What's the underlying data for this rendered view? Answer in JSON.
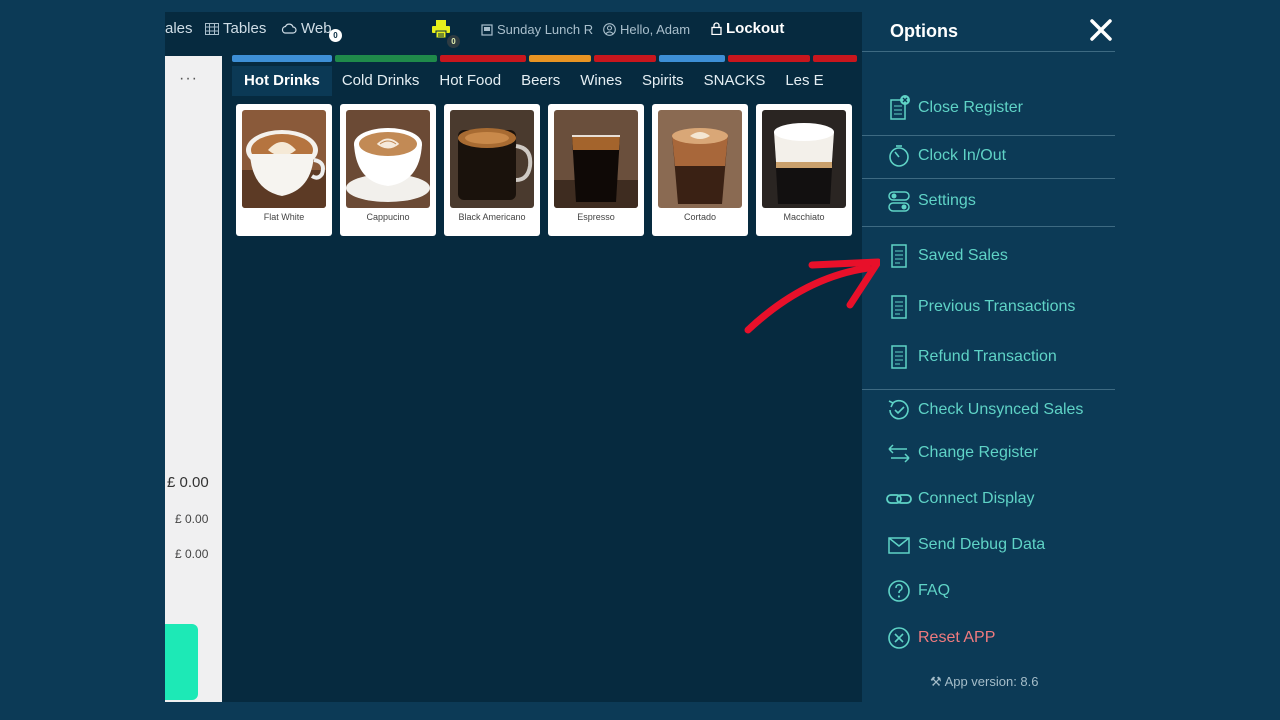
{
  "topbar": {
    "sales_label": "ales",
    "tables_label": "Tables",
    "web_label": "Web",
    "web_count": "0",
    "printer_count": "0",
    "register_name": "Sunday Lunch R",
    "greeting": "Hello, Adam",
    "lockout_label": "Lockout"
  },
  "sidebar": {
    "menu_label": "···",
    "total": "£ 0.00",
    "subtotal_1": "£ 0.00",
    "subtotal_2": "£ 0.00"
  },
  "category_colors": [
    "#3d8fd6",
    "#1f8a4a",
    "#c8161d",
    "#e89423",
    "#c8161d",
    "#3d8fd6",
    "#c8161d",
    "#c8161d"
  ],
  "tabs": [
    "Hot Drinks",
    "Cold Drinks",
    "Hot Food",
    "Beers",
    "Wines",
    "Spirits",
    "SNACKS",
    "Les E"
  ],
  "products": [
    {
      "name": "Flat White"
    },
    {
      "name": "Cappucino"
    },
    {
      "name": "Black Americano"
    },
    {
      "name": "Espresso"
    },
    {
      "name": "Cortado"
    },
    {
      "name": "Macchiato"
    }
  ],
  "options": {
    "title": "Options",
    "items": [
      {
        "label": "Close Register",
        "icon": "register-close-icon"
      },
      {
        "label": "Clock In/Out",
        "icon": "clock-icon"
      },
      {
        "label": "Settings",
        "icon": "toggles-icon"
      },
      {
        "label": "Saved Sales",
        "icon": "receipt-icon"
      },
      {
        "label": "Previous Transactions",
        "icon": "receipt-icon"
      },
      {
        "label": "Refund Transaction",
        "icon": "receipt-icon"
      },
      {
        "label": "Check Unsynced Sales",
        "icon": "sync-check-icon"
      },
      {
        "label": "Change Register",
        "icon": "swap-arrows-icon"
      },
      {
        "label": "Connect Display",
        "icon": "link-icon"
      },
      {
        "label": "Send Debug Data",
        "icon": "mail-icon"
      },
      {
        "label": "FAQ",
        "icon": "question-icon"
      },
      {
        "label": "Reset APP",
        "icon": "reset-icon"
      }
    ],
    "version": "App version: 8.6"
  },
  "colors": {
    "accent": "#5fd3c6",
    "danger": "#f07a7e",
    "pay_button": "#1de9b6",
    "annotation_arrow": "#e8102a"
  }
}
